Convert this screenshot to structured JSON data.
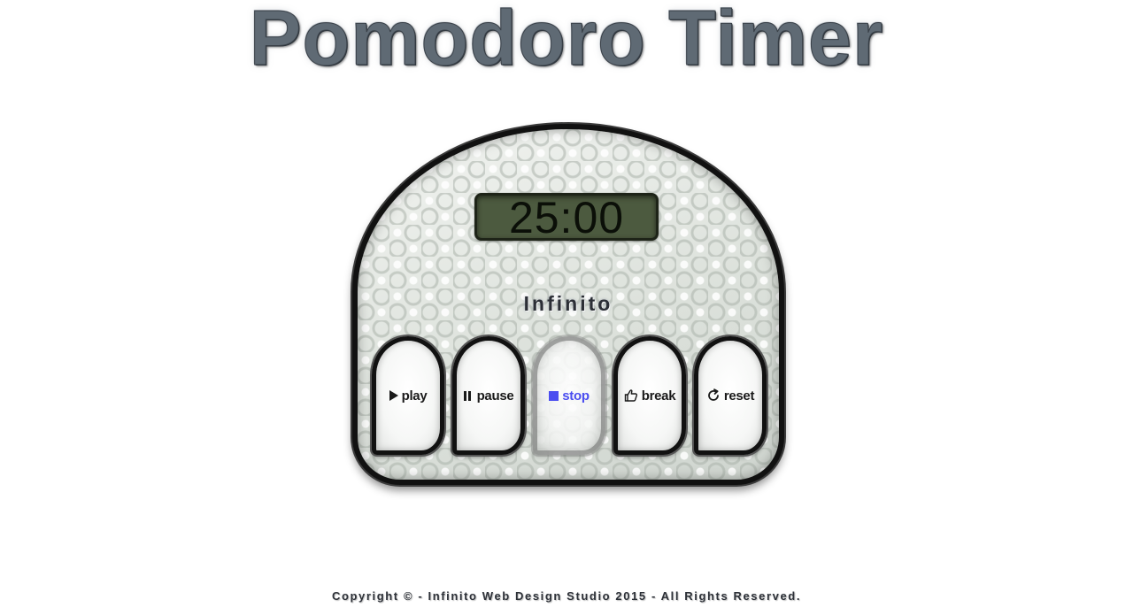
{
  "header": {
    "title": "Pomodoro Timer"
  },
  "timer": {
    "display": "25:00",
    "brand": "Infinito"
  },
  "controls": {
    "play_label": "play",
    "pause_label": "pause",
    "stop_label": "stop",
    "break_label": "break",
    "reset_label": "reset",
    "icons": {
      "play": "play-icon",
      "pause": "pause-icon",
      "stop": "stop-icon",
      "break": "thumbs-up-icon",
      "reset": "reset-icon"
    },
    "active_button": "stop",
    "active_color": "#4b4ef0"
  },
  "footer": {
    "copyright": "Copyright © - Infinito Web Design Studio 2015 - All Rights Reserved."
  },
  "colors": {
    "display_bg": "#4c5a3f",
    "title_color": "#5f6a74"
  }
}
